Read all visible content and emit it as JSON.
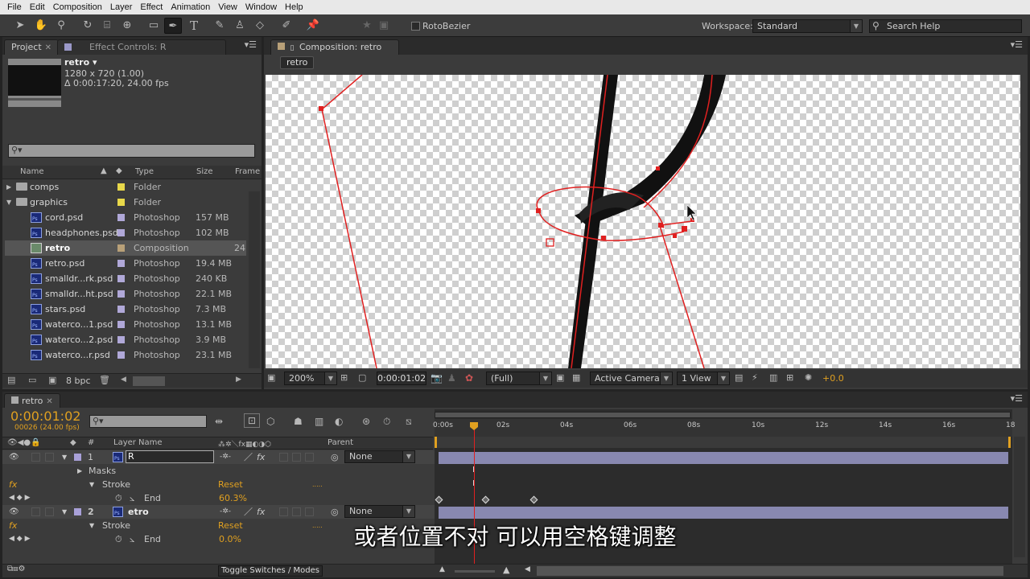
{
  "menu": [
    "File",
    "Edit",
    "Composition",
    "Layer",
    "Effect",
    "Animation",
    "View",
    "Window",
    "Help"
  ],
  "toolbar": {
    "rotobezier_label": "RotoBezier",
    "workspace_label": "Workspace:",
    "workspace_value": "Standard",
    "search_placeholder": "Search Help"
  },
  "project_panel": {
    "tab_project": "Project",
    "tab_effect_controls": "Effect Controls: R",
    "comp_name": "retro ▾",
    "comp_dims": "1280 x 720 (1.00)",
    "comp_duration": "Δ 0:00:17:20, 24.00 fps",
    "columns": {
      "name": "Name",
      "type": "Type",
      "size": "Size",
      "frame": "Frame"
    },
    "items": [
      {
        "name": "comps",
        "type": "Folder",
        "size": "",
        "frame": "",
        "kind": "folder",
        "label_color": "#e8d84a",
        "twirl": "▶"
      },
      {
        "name": "graphics",
        "type": "Folder",
        "size": "",
        "frame": "",
        "kind": "folder",
        "label_color": "#e8d84a",
        "twirl": "▼"
      },
      {
        "name": "cord.psd",
        "type": "Photoshop",
        "size": "157 MB",
        "frame": "",
        "kind": "psd",
        "label_color": "#b0a8d8"
      },
      {
        "name": "headphones.psd",
        "type": "Photoshop",
        "size": "102 MB",
        "frame": "",
        "kind": "psd",
        "label_color": "#b0a8d8"
      },
      {
        "name": "retro",
        "type": "Composition",
        "size": "",
        "frame": "24",
        "kind": "comp",
        "label_color": "#b8a078",
        "selected": true
      },
      {
        "name": "retro.psd",
        "type": "Photoshop",
        "size": "19.4 MB",
        "frame": "",
        "kind": "psd",
        "label_color": "#b0a8d8"
      },
      {
        "name": "smalldr...rk.psd",
        "type": "Photoshop",
        "size": "240 KB",
        "frame": "",
        "kind": "psd",
        "label_color": "#b0a8d8"
      },
      {
        "name": "smalldr...ht.psd",
        "type": "Photoshop",
        "size": "22.1 MB",
        "frame": "",
        "kind": "psd",
        "label_color": "#b0a8d8"
      },
      {
        "name": "stars.psd",
        "type": "Photoshop",
        "size": "7.3 MB",
        "frame": "",
        "kind": "psd",
        "label_color": "#b0a8d8"
      },
      {
        "name": "waterco...1.psd",
        "type": "Photoshop",
        "size": "13.1 MB",
        "frame": "",
        "kind": "psd",
        "label_color": "#b0a8d8"
      },
      {
        "name": "waterco...2.psd",
        "type": "Photoshop",
        "size": "3.9 MB",
        "frame": "",
        "kind": "psd",
        "label_color": "#b0a8d8"
      },
      {
        "name": "waterco...r.psd",
        "type": "Photoshop",
        "size": "23.1 MB",
        "frame": "",
        "kind": "psd",
        "label_color": "#b0a8d8"
      }
    ],
    "bpc": "8 bpc"
  },
  "comp_panel": {
    "tab_label": "Composition: retro",
    "breadcrumb": "retro",
    "zoom": "200%",
    "timecode": "0:00:01:02",
    "resolution": "(Full)",
    "camera": "Active Camera",
    "views": "1 View",
    "exposure": "+0.0"
  },
  "timeline": {
    "tab_label": "retro",
    "timecode": "0:00:01:02",
    "frame_info": "00026 (24.00 fps)",
    "ruler": [
      "0:00s",
      "02s",
      "04s",
      "06s",
      "08s",
      "10s",
      "12s",
      "14s",
      "16s",
      "18"
    ],
    "col_layer_name": "Layer Name",
    "col_parent": "Parent",
    "col_number": "#",
    "layers": {
      "l1_index": "1",
      "l1_name": "R",
      "l1_parent": "None",
      "masks": "Masks",
      "stroke1": "Stroke",
      "reset1": "Reset",
      "end1_label": "End",
      "end1_value": "60.3%",
      "l2_index": "2",
      "l2_name": "etro",
      "l2_parent": "None",
      "stroke2": "Stroke",
      "reset2": "Reset",
      "end2_label": "End",
      "end2_value": "0.0%"
    },
    "toggle_label": "Toggle Switches / Modes"
  },
  "subtitle": "或者位置不对 可以用空格键调整",
  "colors": {
    "accent_orange": "#e0a020",
    "mask_red": "#e02020",
    "layer_bar": "#8888b0"
  }
}
